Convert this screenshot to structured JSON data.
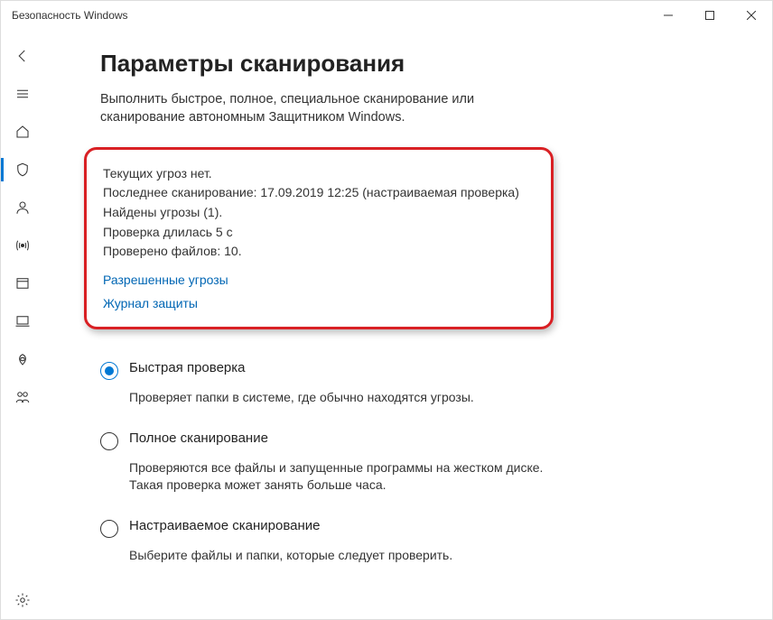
{
  "window": {
    "title": "Безопасность Windows"
  },
  "page": {
    "title": "Параметры сканирования",
    "description": "Выполнить быстрое, полное, специальное сканирование или сканирование автономным Защитником Windows."
  },
  "status": {
    "no_threats": "Текущих угроз нет.",
    "last_scan": "Последнее сканирование: 17.09.2019 12:25 (настраиваемая проверка)",
    "found": "Найдены угрозы (1).",
    "duration": "Проверка длилась 5 с",
    "files": "Проверено файлов: 10.",
    "link_allowed": "Разрешенные угрозы",
    "link_history": "Журнал защиты"
  },
  "options": {
    "quick": {
      "label": "Быстрая проверка",
      "desc": "Проверяет папки в системе, где обычно находятся угрозы.",
      "selected": true
    },
    "full": {
      "label": "Полное сканирование",
      "desc": "Проверяются все файлы и запущенные программы на жестком диске. Такая проверка может занять больше часа.",
      "selected": false
    },
    "custom": {
      "label": "Настраиваемое сканирование",
      "desc": "Выберите файлы и папки, которые следует проверить.",
      "selected": false
    }
  }
}
